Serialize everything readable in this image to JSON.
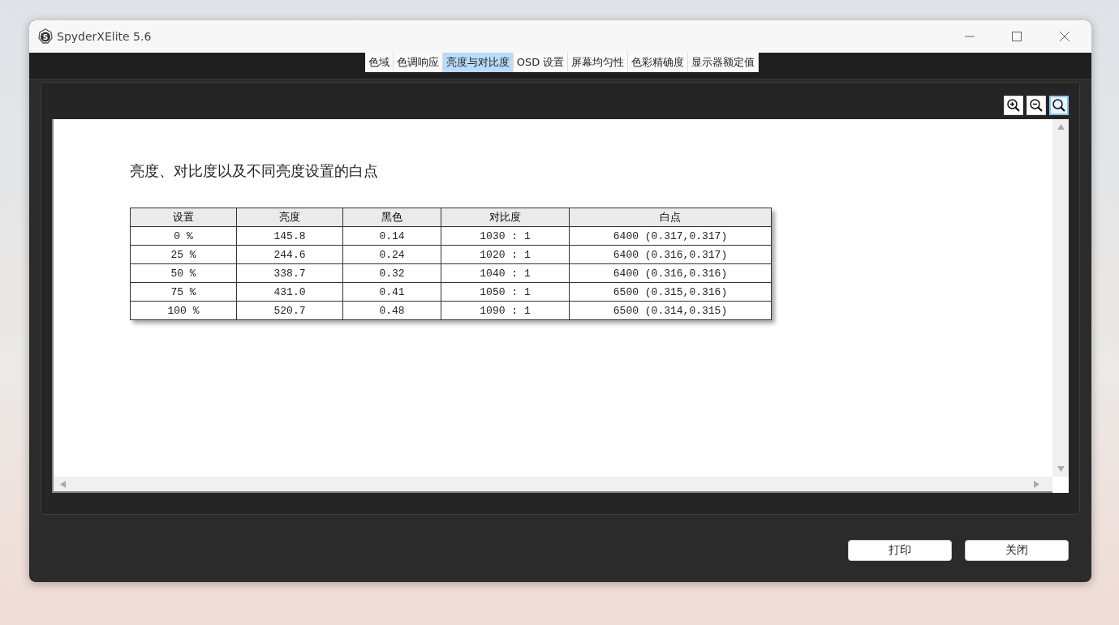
{
  "window": {
    "logo": "S",
    "title": "SpyderXElite 5.6"
  },
  "tabs": [
    {
      "label": "色域",
      "selected": false
    },
    {
      "label": "色调响应",
      "selected": false
    },
    {
      "label": "亮度与对比度",
      "selected": true
    },
    {
      "label": "OSD 设置",
      "selected": false
    },
    {
      "label": "屏幕均匀性",
      "selected": false
    },
    {
      "label": "色彩精确度",
      "selected": false
    },
    {
      "label": "显示器额定值",
      "selected": false
    }
  ],
  "zoom_tools": [
    {
      "kind": "zoom_in",
      "selected": false
    },
    {
      "kind": "zoom_out",
      "selected": false
    },
    {
      "kind": "fit",
      "selected": true
    }
  ],
  "report": {
    "title": "亮度、对比度以及不同亮度设置的白点",
    "table": {
      "columns": [
        "设置",
        "亮度",
        "黑色",
        "对比度",
        "白点"
      ],
      "rows": [
        [
          "0 %",
          "145.8",
          "0.14",
          "1030 : 1",
          "6400 (0.317,0.317)"
        ],
        [
          "25 %",
          "244.6",
          "0.24",
          "1020 : 1",
          "6400 (0.316,0.317)"
        ],
        [
          "50 %",
          "338.7",
          "0.32",
          "1040 : 1",
          "6400 (0.316,0.316)"
        ],
        [
          "75 %",
          "431.0",
          "0.41",
          "1050 : 1",
          "6500 (0.315,0.316)"
        ],
        [
          "100 %",
          "520.7",
          "0.48",
          "1090 : 1",
          "6500 (0.314,0.315)"
        ]
      ]
    }
  },
  "buttons": [
    "打印",
    "关闭"
  ]
}
